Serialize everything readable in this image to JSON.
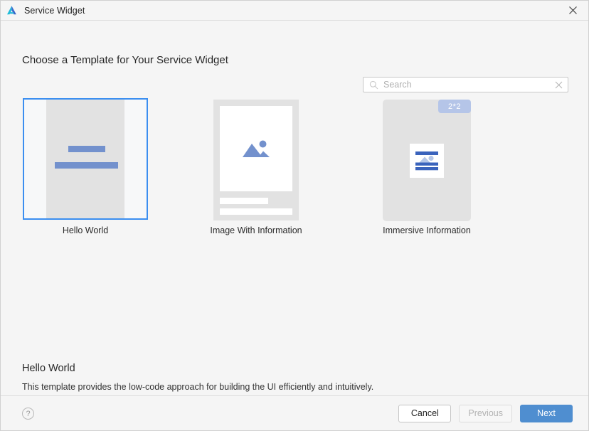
{
  "window": {
    "title": "Service Widget",
    "app_icon": "deveco-logo-icon",
    "close_label": "×"
  },
  "header": {
    "page_title": "Choose a Template for Your Service Widget"
  },
  "search": {
    "placeholder": "Search",
    "value": "",
    "icon": "search-icon",
    "clear_icon": "clear-icon"
  },
  "templates": [
    {
      "label": "Hello World",
      "selected": true,
      "preview": "two-blue-bars"
    },
    {
      "label": "Image With Information",
      "selected": false,
      "preview": "image-placeholder-with-text-lines"
    },
    {
      "label": "Immersive Information",
      "selected": false,
      "preview": "immersive-card",
      "badge": "2*2"
    }
  ],
  "description": {
    "title": "Hello World",
    "body": "This template provides the low-code approach for building the UI efficiently and intuitively."
  },
  "footer": {
    "help_label": "?",
    "cancel_label": "Cancel",
    "previous_label": "Previous",
    "next_label": "Next"
  },
  "colors": {
    "accent": "#3b8ef0",
    "primary_button": "#4f8ed0",
    "preview_bar": "#7391cd",
    "badge_bg": "#b5c5e8",
    "window_bg": "#f5f5f5",
    "preview_bg": "#e2e2e2"
  }
}
